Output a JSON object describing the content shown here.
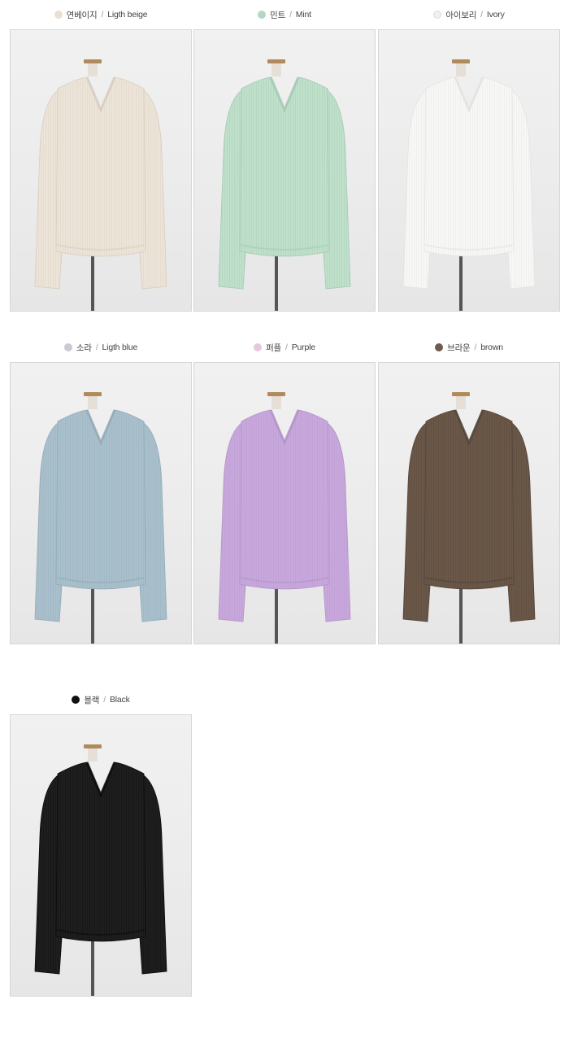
{
  "colors": [
    {
      "ko": "연베이지",
      "en": "Ligth beige",
      "swatch": "#e9dfd2",
      "knit": "#ece4d8",
      "shade": "#d8cdbf"
    },
    {
      "ko": "민트",
      "en": "Mint",
      "swatch": "#b3d8c2",
      "knit": "#bfe0cb",
      "shade": "#a5c9b3"
    },
    {
      "ko": "아이보리",
      "en": "Ivory",
      "swatch": "#f1f0ec",
      "knit": "#f7f7f5",
      "shade": "#e3e3df"
    },
    {
      "ko": "소라",
      "en": "Ligth blue",
      "swatch": "#c8ccd2",
      "knit": "#a9c0cc",
      "shade": "#93aab7"
    },
    {
      "ko": "퍼플",
      "en": "Purple",
      "swatch": "#e3c9da",
      "knit": "#c8a8dc",
      "shade": "#b393c8"
    },
    {
      "ko": "브라운",
      "en": "brown",
      "swatch": "#6f5a4c",
      "knit": "#6a5747",
      "shade": "#54453a"
    },
    {
      "ko": "블랙",
      "en": "Black",
      "swatch": "#111111",
      "knit": "#1e1e1e",
      "shade": "#0b0b0b"
    }
  ]
}
